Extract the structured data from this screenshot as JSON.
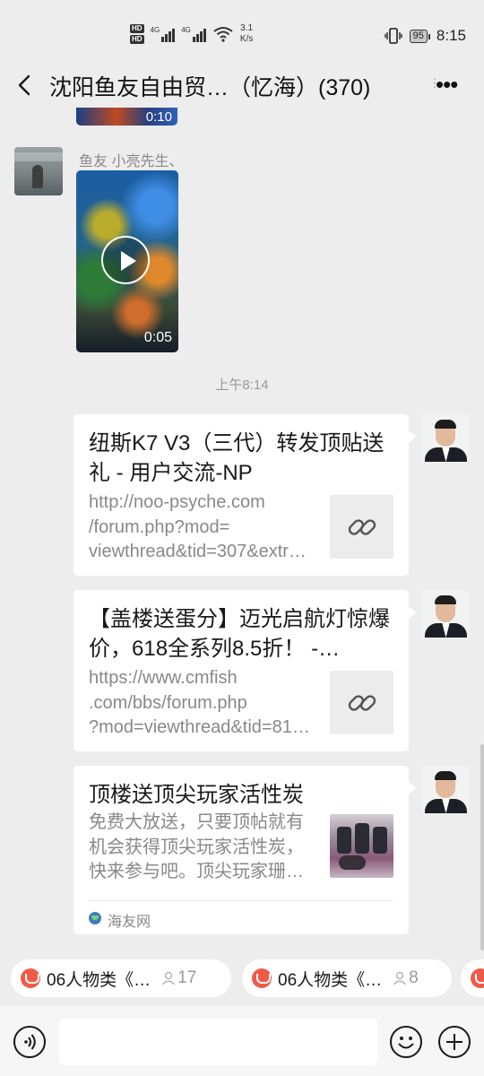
{
  "status_bar": {
    "hd1": "HD",
    "hd2": "HD",
    "net1": "4G",
    "net2": "4G",
    "speed_value": "3.1",
    "speed_unit": "K/s",
    "battery": "95",
    "time": "8:15"
  },
  "header": {
    "title": "沈阳鱼友自由贸…（忆海）(370)",
    "back_icon": "chevron-left-icon",
    "more_icon": "more-dots-icon",
    "side_glyph": "⋮"
  },
  "chat": {
    "prev_video": {
      "duration": "0:10"
    },
    "incoming": {
      "sender": "鱼友 小亮先生、",
      "video_duration": "0:05"
    },
    "timestamp": "上午8:14",
    "cards": [
      {
        "title": "纽斯K7 V3（三代）转发顶贴送礼 - 用户交流-NP",
        "desc_lines": [
          "http://noo-psyche.com",
          "/forum.php?mod=",
          "viewthread&tid=307&extr…"
        ],
        "thumb": "link-icon"
      },
      {
        "title": "【盖楼送蛋分】迈光启航灯惊爆价，618全系列8.5折！ -…",
        "desc_lines": [
          "https://www.cmfish",
          ".com/bbs/forum.php",
          "?mod=viewthread&tid=81…"
        ],
        "thumb": "link-icon"
      },
      {
        "title": "顶楼送顶尖玩家活性炭",
        "desc_lines": [
          "免费大放送，只要顶帖就有",
          "机会获得顶尖玩家活性炭，",
          "快来参与吧。顶尖玩家珊…"
        ],
        "thumb": "product-image",
        "source": "海友网"
      }
    ]
  },
  "chips": [
    {
      "label": "06人物类《…",
      "count": "17"
    },
    {
      "label": "06人物类《…",
      "count": "8"
    }
  ],
  "input_bar": {
    "voice_icon": "voice-icon",
    "emoji_icon": "emoji-icon",
    "plus_icon": "plus-icon"
  },
  "colors": {
    "background": "#ededed",
    "card": "#ffffff",
    "muted_text": "#888888",
    "chip_accent": "#ef5b48"
  }
}
